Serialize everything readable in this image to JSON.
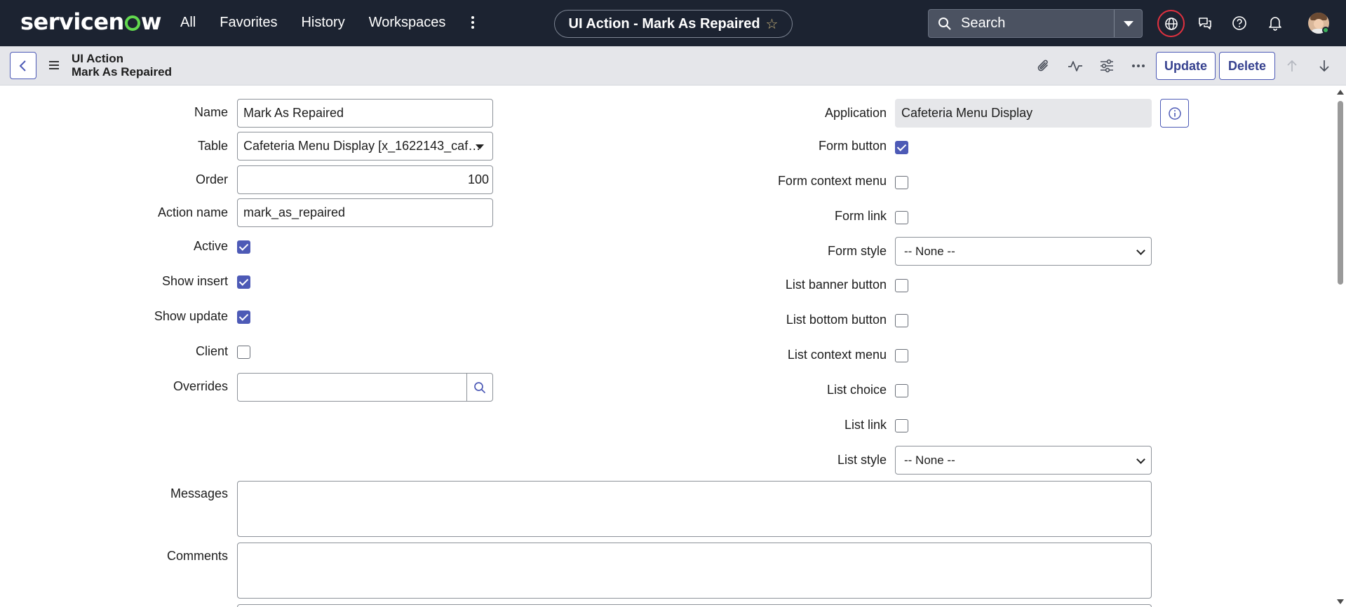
{
  "nav": {
    "logo": "servicenow",
    "links": [
      "All",
      "Favorites",
      "History",
      "Workspaces"
    ],
    "record_title": "UI Action - Mark As Repaired",
    "search_placeholder": "Search",
    "icons": [
      "more-vert-icon",
      "star-icon",
      "search-icon",
      "globe-icon",
      "chat-icon",
      "help-icon",
      "bell-icon"
    ]
  },
  "header": {
    "table_label": "UI Action",
    "record_name": "Mark As Repaired",
    "update_label": "Update",
    "delete_label": "Delete",
    "icons": [
      "back-icon",
      "menu-icon",
      "paperclip-icon",
      "activity-icon",
      "settings-sliders-icon",
      "more-horiz-icon",
      "arrow-up-icon",
      "arrow-down-icon"
    ]
  },
  "form": {
    "left": {
      "name_label": "Name",
      "name_value": "Mark As Repaired",
      "table_label": "Table",
      "table_value": "Cafeteria Menu Display [x_1622143_caf…",
      "order_label": "Order",
      "order_value": "100",
      "action_name_label": "Action name",
      "action_name_value": "mark_as_repaired",
      "active_label": "Active",
      "active": true,
      "show_insert_label": "Show insert",
      "show_insert": true,
      "show_update_label": "Show update",
      "show_update": true,
      "client_label": "Client",
      "client": false,
      "overrides_label": "Overrides",
      "overrides_value": ""
    },
    "right": {
      "application_label": "Application",
      "application_value": "Cafeteria Menu Display",
      "form_button_label": "Form button",
      "form_button": true,
      "form_context_menu_label": "Form context menu",
      "form_context_menu": false,
      "form_link_label": "Form link",
      "form_link": false,
      "form_style_label": "Form style",
      "form_style_value": "-- None --",
      "list_banner_button_label": "List banner button",
      "list_banner_button": false,
      "list_bottom_button_label": "List bottom button",
      "list_bottom_button": false,
      "list_context_menu_label": "List context menu",
      "list_context_menu": false,
      "list_choice_label": "List choice",
      "list_choice": false,
      "list_link_label": "List link",
      "list_link": false,
      "list_style_label": "List style",
      "list_style_value": "-- None --"
    },
    "messages_label": "Messages",
    "messages_value": "",
    "comments_label": "Comments",
    "comments_value": ""
  },
  "colors": {
    "topnav_bg": "#1c2331",
    "header_bg": "#e5e6ea",
    "accent": "#4d5ab6",
    "logo_green": "#62d84e",
    "globe_ring": "#e0313f"
  }
}
